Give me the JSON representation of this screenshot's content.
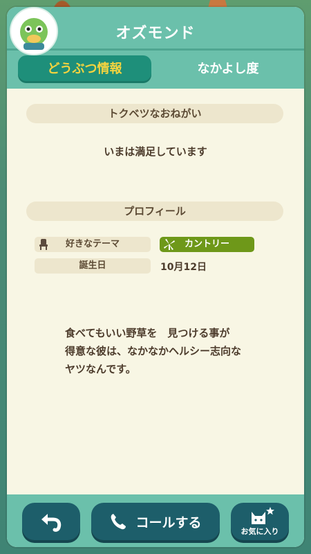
{
  "header": {
    "title": "オズモンド"
  },
  "tabs": [
    {
      "label": "どうぶつ情報",
      "active": true
    },
    {
      "label": "なかよし度",
      "active": false
    }
  ],
  "special_request": {
    "heading": "トクベツなおねがい",
    "text": "いまは満足しています"
  },
  "profile": {
    "heading": "プロフィール",
    "theme_label": "好きなテーマ",
    "theme_value": "カントリー",
    "birthday_label": "誕生日",
    "birthday_value": "10月12日",
    "description": "食べてもいい野草を　見つける事が\n得意な彼は、なかなかヘルシー志向な\nヤツなんです。"
  },
  "footer": {
    "call_label": "コールする",
    "favorite_label": "お気に入り"
  },
  "colors": {
    "header": "#6bc0ab",
    "active_tab": "#1e8f7a",
    "active_tab_text": "#f3d33f",
    "panel": "#f8f6e4",
    "theme_badge": "#6e9819",
    "button": "#1d5e6a"
  },
  "icons": {
    "theme_label_icon": "chair-icon",
    "theme_badge_icon": "windmill-icon",
    "back": "back-arrow-icon",
    "call": "phone-icon",
    "favorite": "cat-star-icon"
  }
}
